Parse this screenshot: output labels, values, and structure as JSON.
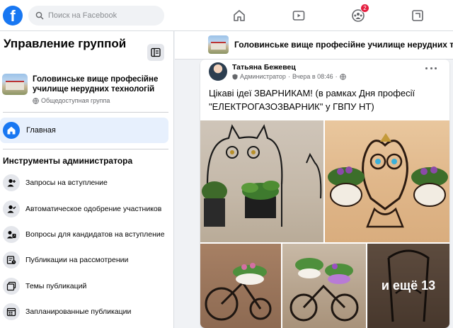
{
  "topbar": {
    "logo": "f",
    "search_placeholder": "Поиск на Facebook",
    "groups_badge": "2",
    "nav_icons": [
      "home-icon",
      "video-icon",
      "groups-icon",
      "gaming-icon"
    ]
  },
  "sidebar": {
    "title": "Управление группой",
    "group_name": "Головинське вище професійне училище нерудних технологій",
    "group_privacy": "Общедоступная группа",
    "home_label": "Главная",
    "admin_tools_heading": "Инструменты администратора",
    "admin_items": [
      {
        "label": "Запросы на вступление",
        "icon": "user-plus-icon"
      },
      {
        "label": "Автоматическое одобрение участников",
        "icon": "user-check-icon"
      },
      {
        "label": "Вопросы для кандидатов на вступление",
        "icon": "question-icon"
      },
      {
        "label": "Публикации на рассмотрении",
        "icon": "pending-posts-icon"
      },
      {
        "label": "Темы публикаций",
        "icon": "topics-icon"
      },
      {
        "label": "Запланированные публикации",
        "icon": "calendar-icon"
      }
    ]
  },
  "main": {
    "group_title": "Головинське вище професійне училище нерудних техно"
  },
  "post": {
    "author": "Татьяна Бежевец",
    "role": "Администратор",
    "time": "Вчера в 08:46",
    "text": "Цікаві ідеї ЗВАРНИКАМ! (в рамках Дня професії \"ЕЛЕКТРОГАЗОЗВАРНИК\" у ГВПУ НТ)",
    "more_photos": "и ещё 13"
  },
  "colors": {
    "brand": "#1877f2",
    "badge": "#e41e3f",
    "active_bg": "#e7f0fd"
  }
}
